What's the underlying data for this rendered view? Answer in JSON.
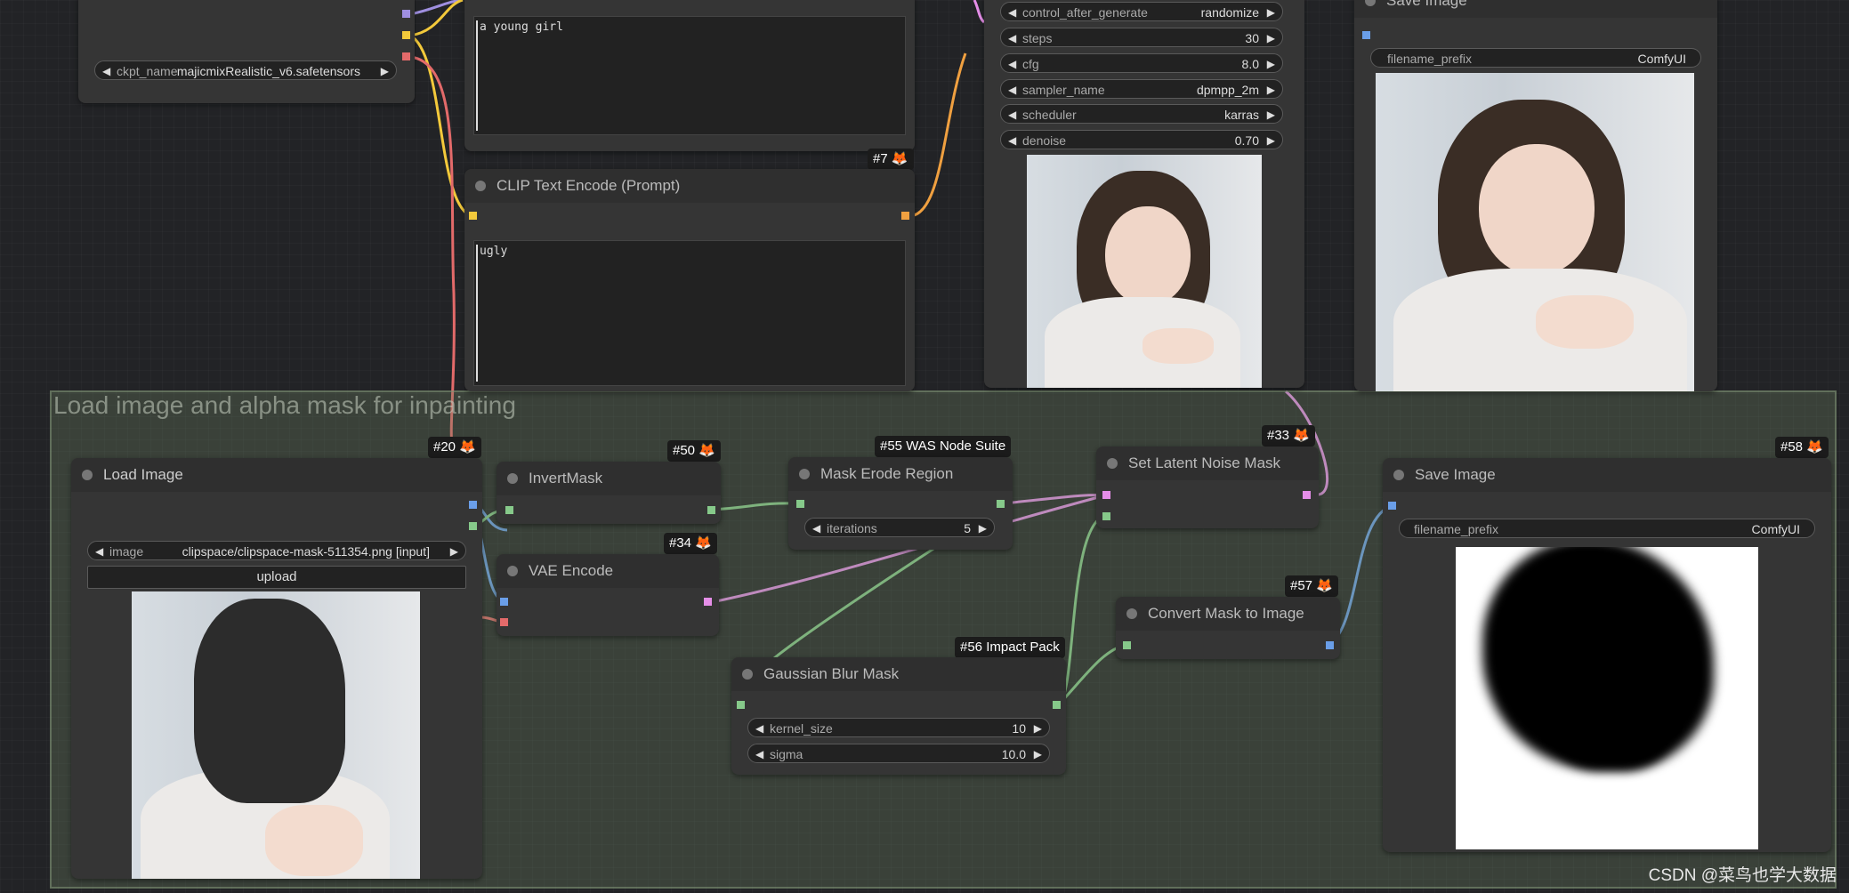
{
  "group": {
    "title": "Load image and alpha mask for inpainting"
  },
  "checkpoint_node": {
    "ckpt_label": "ckpt_name",
    "ckpt_value": "majicmixRealistic_v6.safetensors"
  },
  "positive_prompt": {
    "text": "a young girl"
  },
  "clip_node": {
    "badge": "#7",
    "title": "CLIP Text Encode (Prompt)",
    "text": "ugly"
  },
  "ksampler": {
    "widgets": [
      {
        "label": "control_after_generate",
        "value": "randomize"
      },
      {
        "label": "steps",
        "value": "30"
      },
      {
        "label": "cfg",
        "value": "8.0"
      },
      {
        "label": "sampler_name",
        "value": "dpmpp_2m"
      },
      {
        "label": "scheduler",
        "value": "karras"
      },
      {
        "label": "denoise",
        "value": "0.70"
      }
    ]
  },
  "save_top": {
    "title": "Save Image",
    "prefix_label": "filename_prefix",
    "prefix_value": "ComfyUI"
  },
  "load_image": {
    "badge": "#20",
    "title": "Load Image",
    "image_label": "image",
    "image_value": "clipspace/clipspace-mask-511354.png [input]",
    "upload_label": "upload"
  },
  "invert_mask": {
    "badge": "#50",
    "title": "InvertMask"
  },
  "vae_encode": {
    "badge": "#34",
    "title": "VAE Encode"
  },
  "mask_erode": {
    "badge": "#55 WAS Node Suite",
    "title": "Mask Erode Region",
    "iter_label": "iterations",
    "iter_value": "5"
  },
  "gaussian": {
    "badge": "#56 Impact Pack",
    "title": "Gaussian Blur Mask",
    "k_label": "kernel_size",
    "k_value": "10",
    "s_label": "sigma",
    "s_value": "10.0"
  },
  "latent_mask": {
    "badge": "#33",
    "title": "Set Latent Noise Mask"
  },
  "convert_mask": {
    "badge": "#57",
    "title": "Convert Mask to Image"
  },
  "save_bottom": {
    "badge": "#58",
    "title": "Save Image",
    "prefix_label": "filename_prefix",
    "prefix_value": "ComfyUI"
  },
  "watermark": "CSDN @菜鸟也学大数据",
  "colors": {
    "clip": "#f3c93b",
    "conditioning": "#f0a040",
    "vae": "#e36a6a",
    "latent": "#e58ee8",
    "mask": "#86c98a",
    "image": "#6a9ee8",
    "model": "#9f8fe0"
  }
}
